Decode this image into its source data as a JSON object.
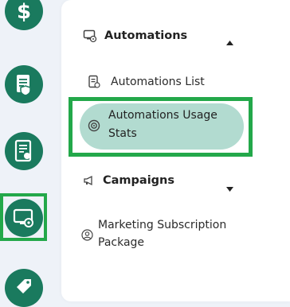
{
  "sidebar": {
    "rail_icons": [
      {
        "name": "dollar-icon"
      },
      {
        "name": "policy-document-icon"
      },
      {
        "name": "report-chart-icon"
      },
      {
        "name": "automation-monitor-icon",
        "active": true
      },
      {
        "name": "campaign-tag-icon"
      }
    ]
  },
  "menu": {
    "sections": [
      {
        "label": "Automations",
        "icon": "automations-icon",
        "expanded": true,
        "items": [
          {
            "label": "Automations List",
            "icon": "list-document-icon"
          },
          {
            "label": "Automations Usage Stats",
            "icon": "usage-stats-icon",
            "active": true
          }
        ]
      },
      {
        "label": "Campaigns",
        "icon": "megaphone-icon",
        "expanded": false,
        "items": []
      }
    ],
    "extra_item": {
      "label": "Marketing Subscription Package",
      "icon": "user-circle-icon"
    }
  },
  "colors": {
    "accent": "#1a7a5e",
    "active_fill": "#b2dbd0",
    "highlight": "#23a84a"
  }
}
